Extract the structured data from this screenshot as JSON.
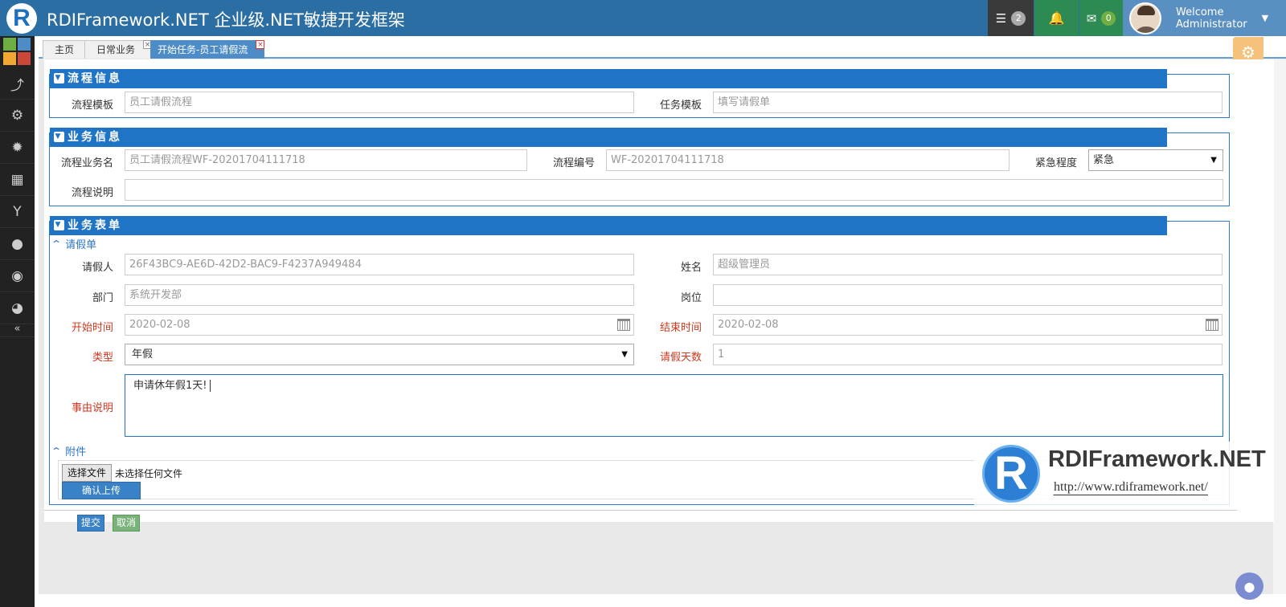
{
  "app": {
    "logo_letter": "R",
    "title": "RDIFramework.NET 企业级.NET敏捷开发框架"
  },
  "topbar": {
    "tasks_count": "2",
    "messages_count": "0",
    "user": {
      "welcome": "Welcome",
      "name": "Administrator"
    }
  },
  "tabs": [
    {
      "label": "主页",
      "closable": false
    },
    {
      "label": "日常业务",
      "closable": true
    },
    {
      "label": "开始任务-员工请假流",
      "closable": true,
      "active": true
    }
  ],
  "sections": {
    "flow_info": {
      "title": "流程信息",
      "flow_template_label": "流程模板",
      "flow_template_value": "员工请假流程",
      "task_template_label": "任务模板",
      "task_template_value": "填写请假单"
    },
    "business_info": {
      "title": "业务信息",
      "business_name_label": "流程业务名",
      "business_name_value": "员工请假流程WF-20201704111718",
      "flow_number_label": "流程编号",
      "flow_number_value": "WF-20201704111718",
      "urgency_label": "紧急程度",
      "urgency_value": "紧急",
      "flow_desc_label": "流程说明",
      "flow_desc_value": ""
    },
    "business_form": {
      "title": "业务表单",
      "leave_sub": "请假单",
      "applicant_label": "请假人",
      "applicant_value": "26F43BC9-AE6D-42D2-BAC9-F4237A949484",
      "name_label": "姓名",
      "name_value": "超级管理员",
      "dept_label": "部门",
      "dept_value": "系统开发部",
      "position_label": "岗位",
      "position_value": "",
      "start_label": "开始时间",
      "start_value": "2020-02-08",
      "end_label": "结束时间",
      "end_value": "2020-02-08",
      "type_label": "类型",
      "type_value": "年假",
      "days_label": "请假天数",
      "days_value": "1",
      "reason_label": "事由说明",
      "reason_value": "申请休年假1天!",
      "attach_sub": "附件",
      "choose_file": "选择文件",
      "no_file": "未选择任何文件",
      "confirm_upload": "确认上传"
    }
  },
  "actions": {
    "submit": "提交",
    "cancel": "取消"
  },
  "watermark": {
    "letter": "R",
    "title": "RDIFramework.NET",
    "url": "http://www.rdiframework.net/"
  },
  "colors": {
    "topbar": "#2b6ea3",
    "legend": "#1f74c6",
    "required_label": "#d0391f",
    "submit": "#3a82c7",
    "cancel": "#7ab37a"
  }
}
